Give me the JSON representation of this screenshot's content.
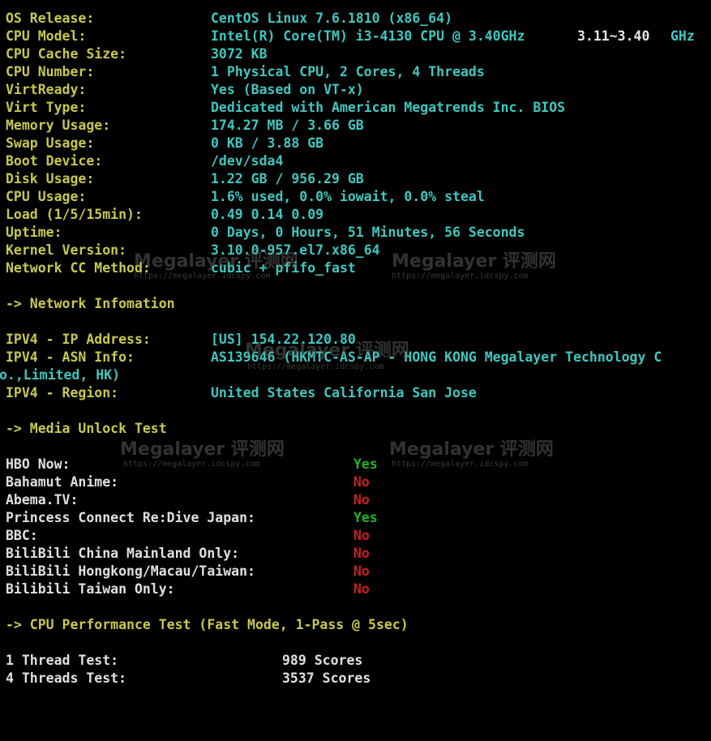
{
  "system_info": [
    {
      "label": "OS Release:",
      "value": "CentOS Linux 7.6.1810 (x86_64)"
    },
    {
      "label": "CPU Model:",
      "value": "Intel(R) Core(TM) i3-4130 CPU @ 3.40GHz",
      "extra": "3.11~3.40",
      "extra_unit": "GHz"
    },
    {
      "label": "CPU Cache Size:",
      "value": "3072 KB"
    },
    {
      "label": "CPU Number:",
      "value": "1 Physical CPU, 2 Cores, 4 Threads"
    },
    {
      "label": "VirtReady:",
      "value": "Yes (Based on VT-x)"
    },
    {
      "label": "Virt Type:",
      "value": "Dedicated with American Megatrends Inc. BIOS"
    },
    {
      "label": "Memory Usage:",
      "value": "174.27 MB / 3.66 GB"
    },
    {
      "label": "Swap Usage:",
      "value": "0 KB / 3.88 GB"
    },
    {
      "label": "Boot Device:",
      "value": "/dev/sda4"
    },
    {
      "label": "Disk Usage:",
      "value": "1.22 GB / 956.29 GB"
    },
    {
      "label": "CPU Usage:",
      "value": "1.6% used, 0.0% iowait, 0.0% steal"
    },
    {
      "label": "Load (1/5/15min):",
      "value": "0.49 0.14 0.09"
    },
    {
      "label": "Uptime:",
      "value": "0 Days, 0 Hours, 51 Minutes, 56 Seconds"
    },
    {
      "label": "Kernel Version:",
      "value": "3.10.0-957.el7.x86_64"
    },
    {
      "label": "Network CC Method:",
      "value": "cubic + pfifo_fast"
    }
  ],
  "network": {
    "section_title": "-> Network Infomation",
    "ipv4_address_label": "IPV4 - IP Address:",
    "ipv4_address_value": "[US] 154.22.120.80",
    "asn_label": "IPV4 - ASN Info:",
    "asn_value": "AS139646 (HKMTC-AS-AP - HONG KONG Megalayer Technology C",
    "asn_value_wrap": "o.,Limited, HK)",
    "region_label": "IPV4 - Region:",
    "region_value": "United States California San Jose"
  },
  "media": {
    "section_title": "-> Media Unlock Test",
    "items": [
      {
        "label": "HBO Now:",
        "result": "Yes",
        "status": "yes"
      },
      {
        "label": "Bahamut Anime:",
        "result": "No",
        "status": "no"
      },
      {
        "label": "Abema.TV:",
        "result": "No",
        "status": "no"
      },
      {
        "label": "Princess Connect Re:Dive Japan:",
        "result": "Yes",
        "status": "yes"
      },
      {
        "label": "BBC:",
        "result": "No",
        "status": "no"
      },
      {
        "label": "BiliBili China Mainland Only:",
        "result": "No",
        "status": "no"
      },
      {
        "label": "BiliBili Hongkong/Macau/Taiwan:",
        "result": "No",
        "status": "no"
      },
      {
        "label": "Bilibili Taiwan Only:",
        "result": "No",
        "status": "no"
      }
    ]
  },
  "cpu_perf": {
    "section_title": "-> CPU Performance Test (Fast Mode, 1-Pass @ 5sec)",
    "tests": [
      {
        "label": "1 Thread Test:",
        "score": "989 Scores"
      },
      {
        "label": "4 Threads Test:",
        "score": "3537 Scores"
      }
    ]
  },
  "watermark": {
    "brand": "Megalayer 评测网",
    "url": "https://megalayer.idcspy.com"
  },
  "colors": {
    "background": "#000000",
    "label": "#c8c850",
    "value": "#3fc7c0",
    "yes": "#22b522",
    "no": "#c81e1e"
  }
}
